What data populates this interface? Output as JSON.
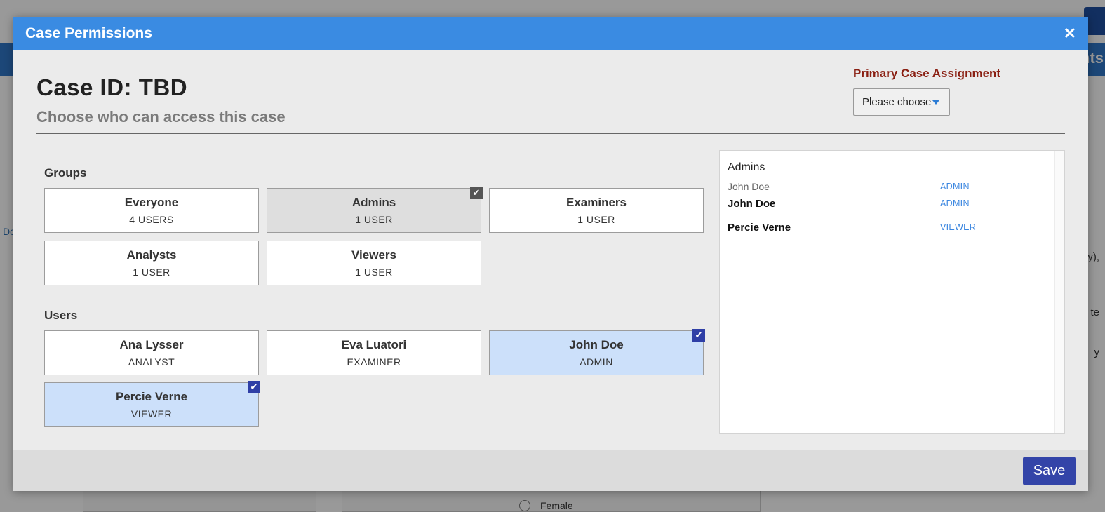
{
  "background": {
    "right_header_fragment": "nts",
    "left_fragment": "Do",
    "right_fragment_1": "y),",
    "right_fragment_2": "te",
    "right_fragment_3": "y",
    "radio_label": "Female"
  },
  "modal": {
    "title": "Case Permissions",
    "close_symbol": "✕",
    "case_id": "Case ID: TBD",
    "subtitle": "Choose who can access this case",
    "primary_assignment": {
      "label": "Primary Case Assignment",
      "selected": "Please choose"
    },
    "groups": {
      "label": "Groups",
      "items": [
        {
          "name": "Everyone",
          "count": "4 USERS",
          "selected": false
        },
        {
          "name": "Admins",
          "count": "1 USER",
          "selected": true
        },
        {
          "name": "Examiners",
          "count": "1 USER",
          "selected": false
        },
        {
          "name": "Analysts",
          "count": "1 USER",
          "selected": false
        },
        {
          "name": "Viewers",
          "count": "1 USER",
          "selected": false
        }
      ]
    },
    "users": {
      "label": "Users",
      "items": [
        {
          "name": "Ana Lysser",
          "role": "ANALYST",
          "selected": false
        },
        {
          "name": "Eva Luatori",
          "role": "EXAMINER",
          "selected": false
        },
        {
          "name": "John Doe",
          "role": "ADMIN",
          "selected": true
        },
        {
          "name": "Percie Verne",
          "role": "VIEWER",
          "selected": true
        }
      ]
    },
    "access_summary": {
      "group_heading": "Admins",
      "rows": [
        {
          "name": "John Doe",
          "role": "ADMIN",
          "style": "member"
        },
        {
          "name": "John Doe",
          "role": "ADMIN",
          "style": "user"
        },
        {
          "name": "Percie Verne",
          "role": "VIEWER",
          "style": "user"
        }
      ]
    },
    "footer": {
      "save_label": "Save"
    }
  },
  "colors": {
    "header_blue": "#3a8be2",
    "save_button": "#3344a8",
    "primary_label": "#8a1f12",
    "selected_user_bg": "#cce0fa",
    "selected_group_bg": "#dedede",
    "role_link": "#3a86e0"
  },
  "icons": {
    "close": "close-icon",
    "dropdown": "caret-down-icon",
    "checkbox": "checkmark-icon"
  }
}
